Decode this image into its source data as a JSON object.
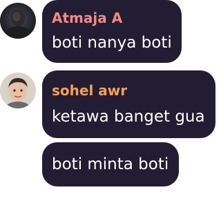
{
  "messages": [
    {
      "sender": "Atmaja A",
      "sender_color": "#f08a8a",
      "text": "boti nanya boti",
      "avatar_icon": "user-avatar-atmaja"
    },
    {
      "sender": "sohel awr",
      "sender_color": "#f5a05a",
      "text": "ketawa banget gua",
      "avatar_icon": "user-avatar-sohel"
    },
    {
      "sender": "",
      "text": "boti minta boti"
    }
  ],
  "colors": {
    "bubble_bg": "#231d33",
    "message_text": "#ffffff"
  }
}
